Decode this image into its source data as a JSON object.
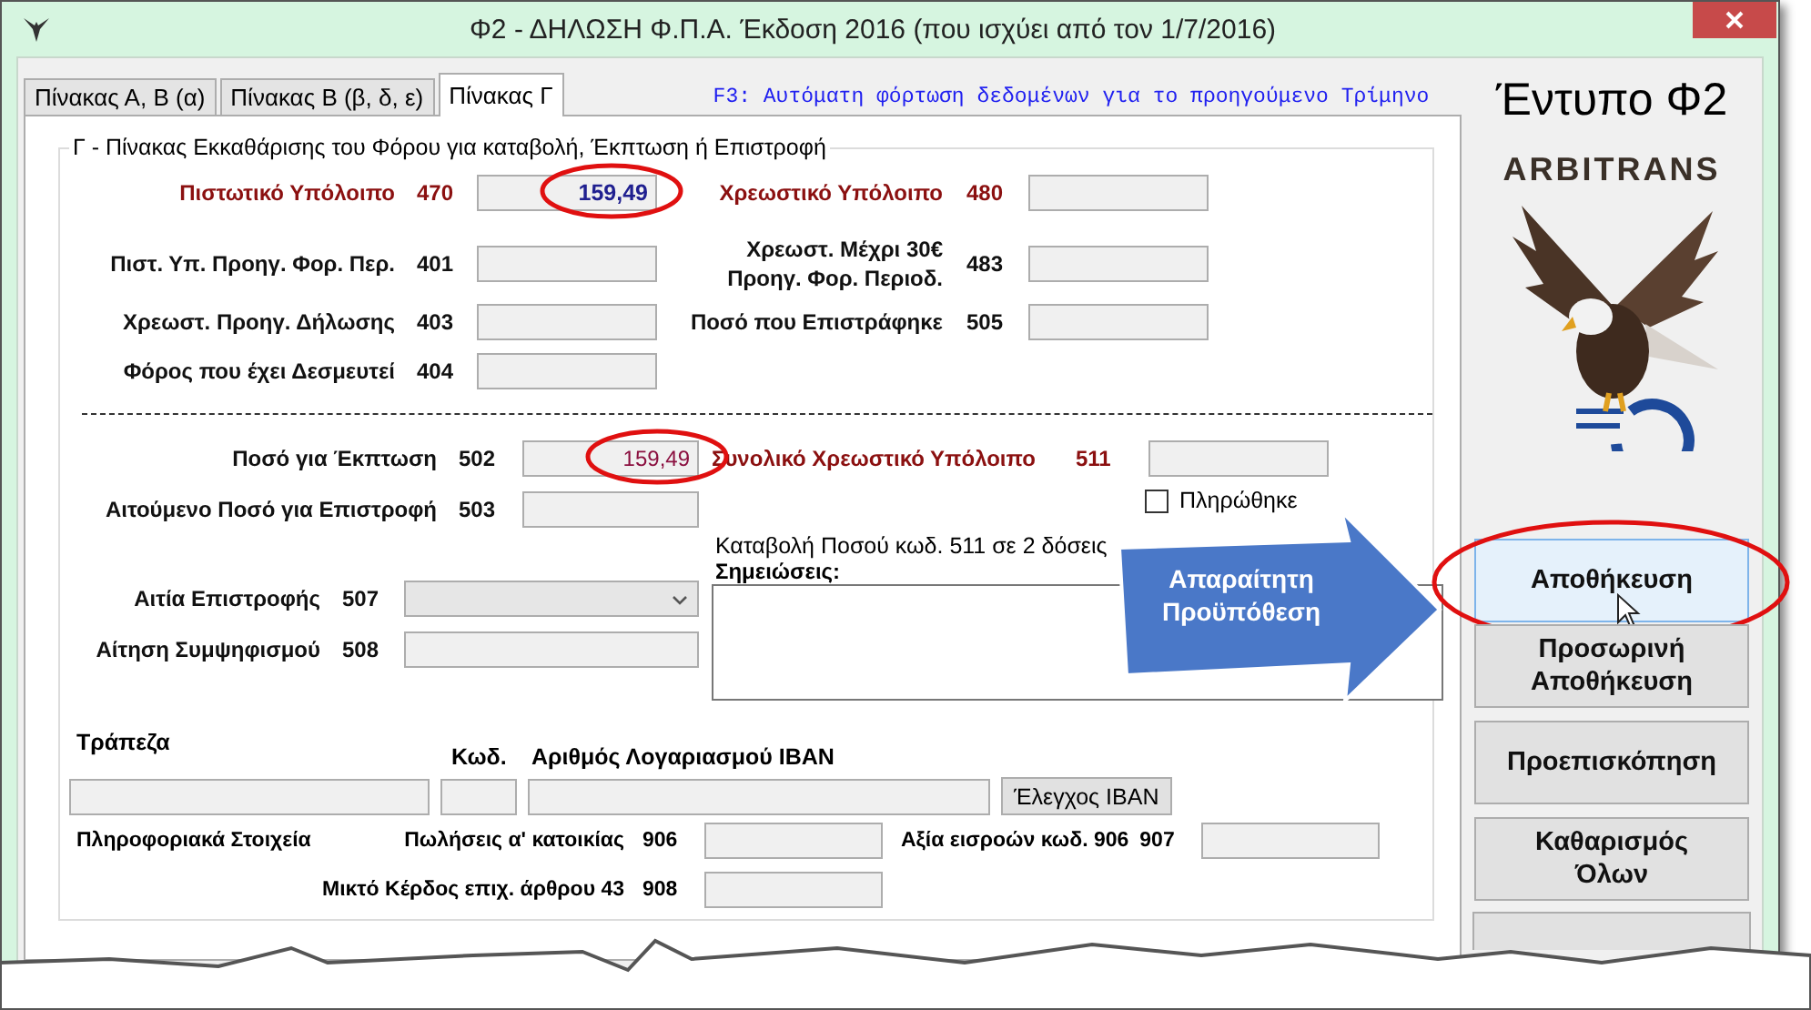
{
  "window": {
    "title": "Φ2 - ΔΗΛΩΣΗ Φ.Π.Α. Έκδοση 2016 (που ισχύει από τον 1/7/2016)"
  },
  "tabs": [
    {
      "label": "Πίνακας Α, Β (α)",
      "selected": false
    },
    {
      "label": "Πίνακας Β (β, δ, ε)",
      "selected": false
    },
    {
      "label": "Πίνακας Γ",
      "selected": true
    }
  ],
  "hint": "F3: Αυτόματη φόρτωση δεδομένων για το προηγούμενο Τρίμηνο",
  "group": {
    "title": "Γ - Πίνακας Εκκαθάρισης του Φόρου για καταβολή, Έκπτωση ή Επιστροφή",
    "balance_rows": [
      {
        "left": {
          "label": "Πιστωτικό Υπόλοιπο",
          "code": "470",
          "value": "159,49",
          "emphasis": true,
          "circled": true
        },
        "right": {
          "label": "Χρεωστικό Υπόλοιπο",
          "code": "480",
          "emphasis": true,
          "circled": false
        }
      },
      {
        "left": {
          "label": "Πιστ. Υπ. Προηγ. Φορ. Περ.",
          "code": "401",
          "emphasis": false,
          "circled": false
        },
        "right": {
          "label": "Χρεωστ. Μέχρι 30€\nΠροηγ. Φορ. Περιοδ.",
          "code": "483",
          "emphasis": false,
          "circled": false
        }
      },
      {
        "left": {
          "label": "Χρεωστ. Προηγ. Δήλωσης",
          "code": "403",
          "emphasis": false,
          "circled": false
        },
        "right": {
          "label": "Ποσό που Επιστράφηκε",
          "code": "505",
          "emphasis": false,
          "circled": false
        }
      },
      {
        "left": {
          "label": "Φόρος που έχει Δεσμευτεί",
          "code": "404",
          "emphasis": false,
          "circled": false
        }
      }
    ],
    "amount_rows": [
      {
        "label": "Ποσό για Έκπτωση",
        "code": "502",
        "value": "159,49",
        "emphasis": false,
        "circled": true
      },
      {
        "label": "Αιτούμενο Ποσό για Επιστροφή",
        "code": "503",
        "emphasis": false,
        "circled": false
      }
    ],
    "total_debit": {
      "label": "Συνολικό Χρεωστικό Υπόλοιπο",
      "code": "511",
      "emphasis": true
    },
    "paid": {
      "label": "Πληρώθηκε",
      "checked": false
    },
    "installments": "Καταβολή Ποσού κωδ. 511 σε 2 δόσεις",
    "notes_label": "Σημειώσεις:",
    "refund_reason": {
      "label": "Αιτία Επιστροφής",
      "code": "507"
    },
    "offset": {
      "label": "Αίτηση Συμψηφισμού",
      "code": "508"
    },
    "bank": {
      "bank_label": "Τράπεζα",
      "code_label": "Κωδ.",
      "iban_label": "Αριθμός Λογαριασμού IBAN",
      "check_button": "Έλεγχος IBAN"
    },
    "info": {
      "label": "Πληροφοριακά Στοιχεία",
      "sales": {
        "label": "Πωλήσεις α' κατοικίας",
        "code": "906"
      },
      "inputs": {
        "label": "Αξία εισροών κωδ. 906",
        "code": "907"
      },
      "profit": {
        "label": "Μικτό Κέρδος επιχ. άρθρου 43",
        "code": "908"
      }
    }
  },
  "side": {
    "heading": "Έντυπο Φ2",
    "brand": "ARBITRANS",
    "buttons": [
      {
        "label": "Αποθήκευση",
        "hovered": true,
        "circled": true
      },
      {
        "label": "Προσωρινή Αποθήκευση",
        "hovered": false,
        "circled": false
      },
      {
        "label": "Προεπισκόπηση",
        "hovered": false,
        "circled": false
      },
      {
        "label": "Καθαρισμός Όλων",
        "hovered": false,
        "circled": false
      }
    ]
  },
  "callout": "Απαραίτητη Προϋπόθεση"
}
